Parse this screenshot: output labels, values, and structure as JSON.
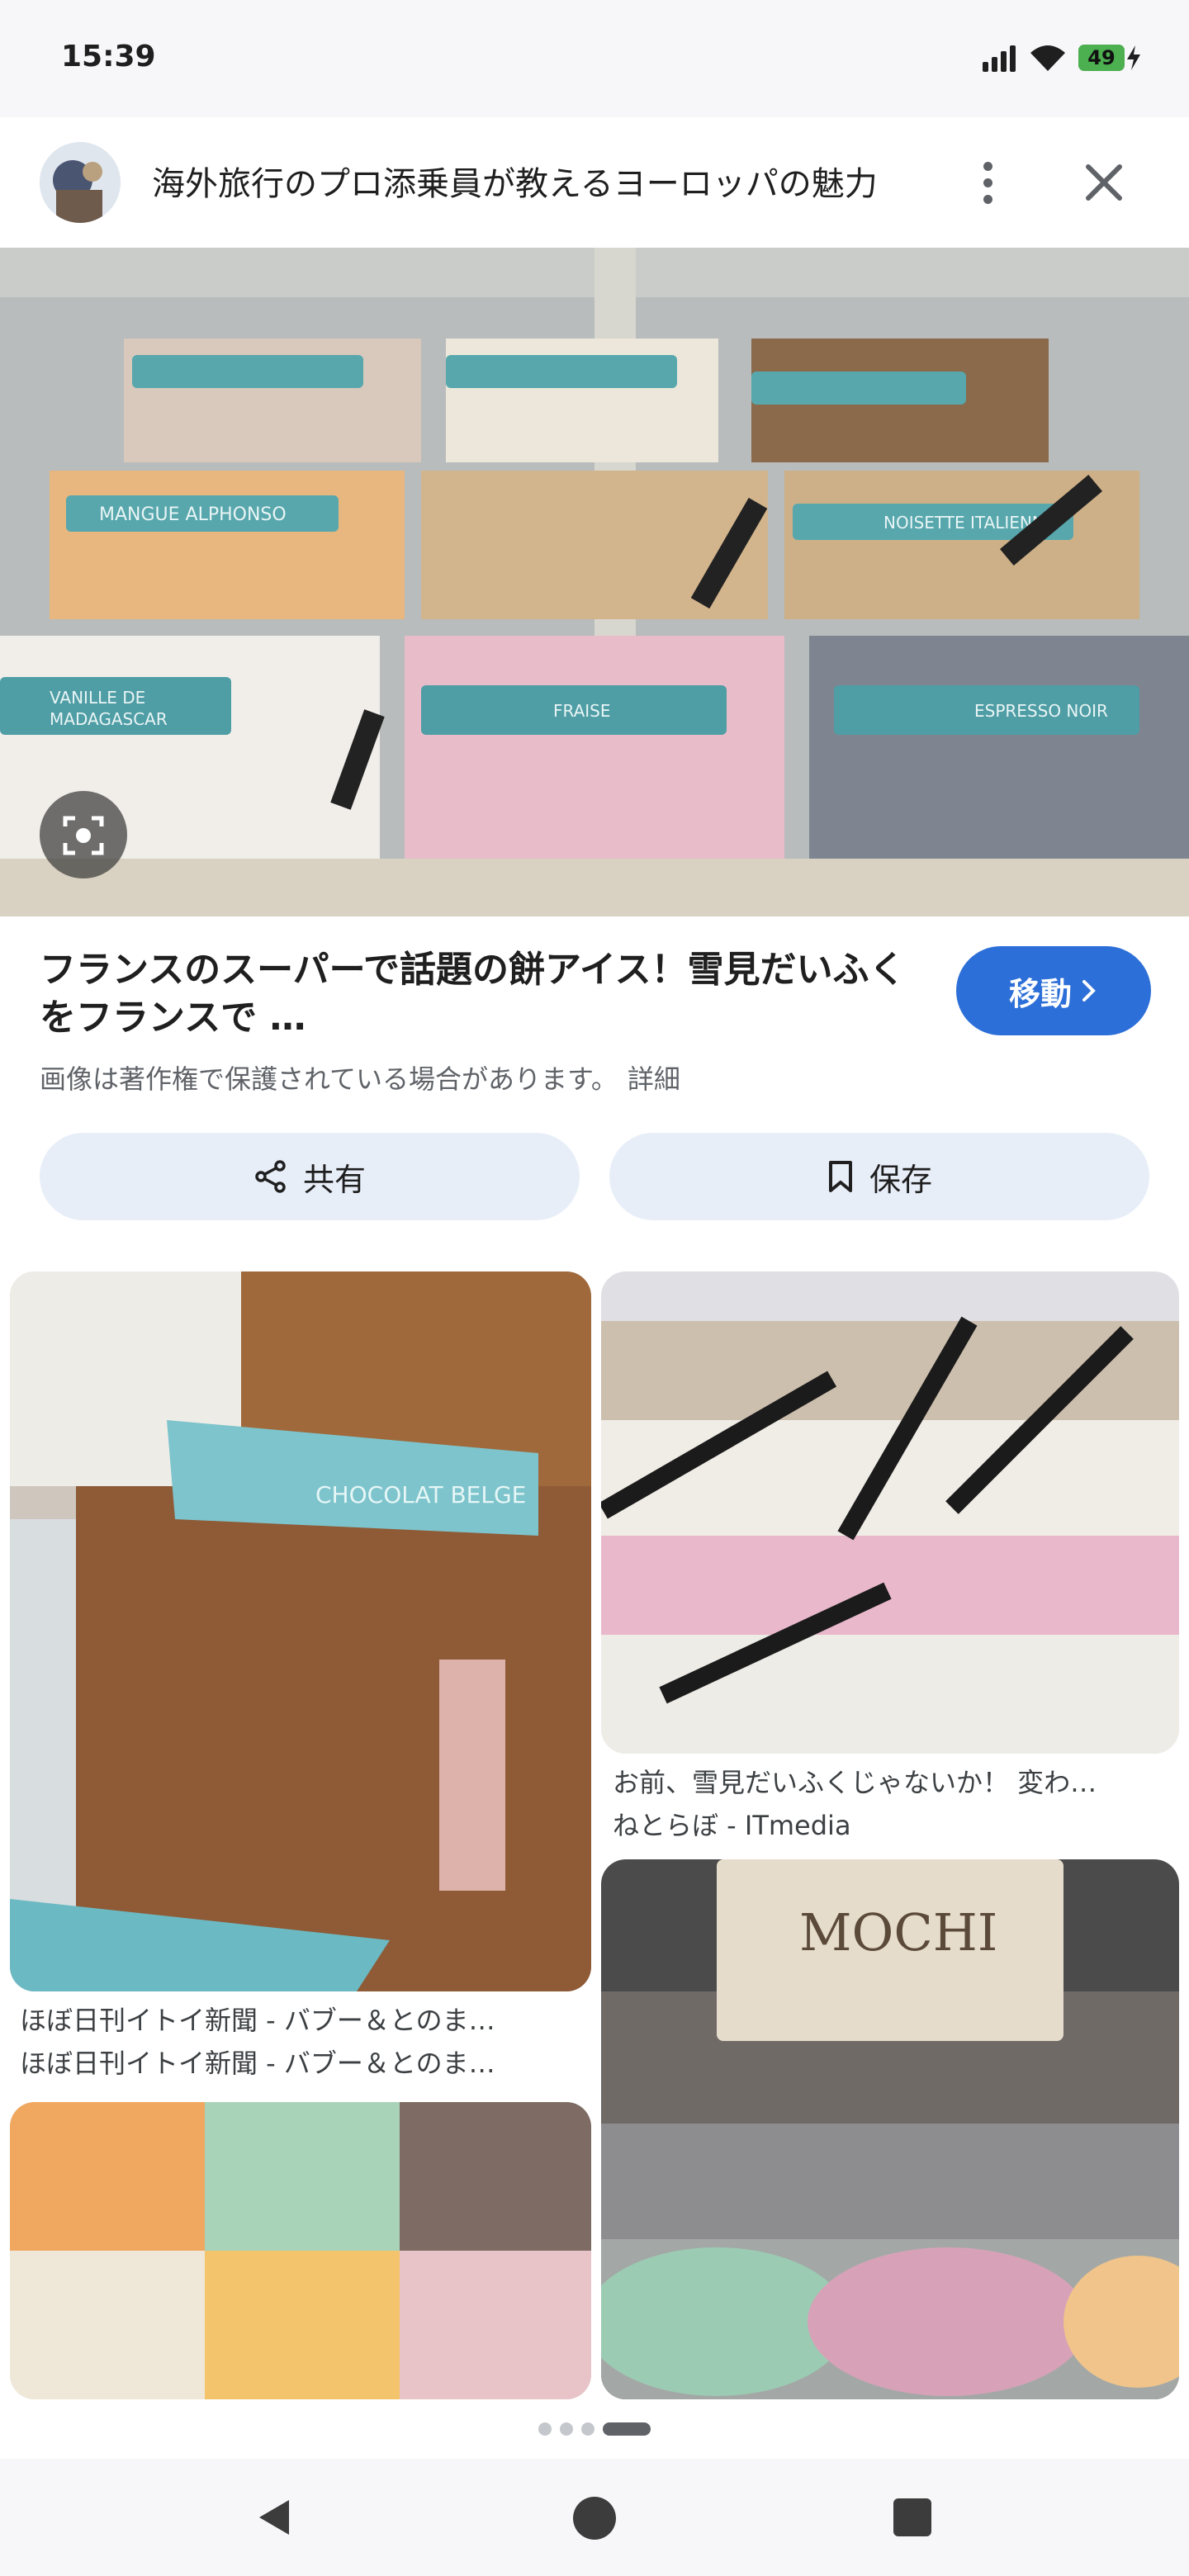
{
  "status_bar": {
    "time": "15:39",
    "battery": "49"
  },
  "header": {
    "title": "海外旅行のプロ添乗員が教えるヨーロッパの魅力"
  },
  "main_image": {
    "labels": [
      "MANGUE ALPHONSO",
      "NOISETTE ITALIENNE",
      "VANILLE DE MADAGASCAR",
      "FRAISE",
      "ESPRESSO NOIR",
      "CHOCOLAT BELGE"
    ]
  },
  "result": {
    "title": "フランスのスーパーで話題の餅アイス！雪見だいふくをフランスで …",
    "copyright": "画像は著作権で保護されている場合があります。",
    "details_link": "詳細",
    "visit_label": "移動"
  },
  "actions": {
    "share_label": "共有",
    "save_label": "保存"
  },
  "related": [
    {
      "label": "CHOCOLAT BELGE",
      "caption": "ほぼ日刊イトイ新聞 - バブー＆とのま…",
      "source": "ほぼ日刊イトイ新聞 - バブー＆とのま…"
    },
    {
      "caption": "お前、雪見だいふくじゃないか！ 変わ…",
      "source": "ねとらぼ - ITmedia"
    },
    {
      "label": "MOCHI"
    }
  ],
  "colors": {
    "accent": "#2d6fd8",
    "chip_bg": "#e8eef8",
    "battery": "#4caf50"
  }
}
